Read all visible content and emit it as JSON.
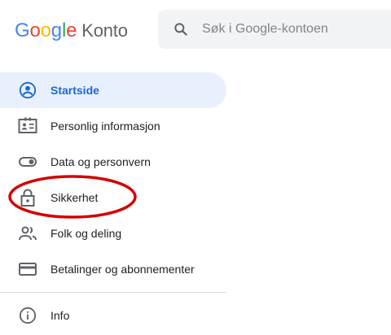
{
  "header": {
    "logo_letters": [
      "G",
      "o",
      "o",
      "g",
      "l",
      "e"
    ],
    "logo_suffix": "Konto",
    "search_placeholder": "Søk i Google-kontoen",
    "search_icon": "search-icon"
  },
  "nav": {
    "items": [
      {
        "label": "Startside",
        "icon": "account-circle-icon",
        "active": true
      },
      {
        "label": "Personlig informasjon",
        "icon": "id-card-icon"
      },
      {
        "label": "Data og personvern",
        "icon": "toggle-icon"
      },
      {
        "label": "Sikkerhet",
        "icon": "lock-icon"
      },
      {
        "label": "Folk og deling",
        "icon": "people-icon"
      },
      {
        "label": "Betalinger og abonnementer",
        "icon": "credit-card-icon"
      }
    ],
    "info": {
      "label": "Info",
      "icon": "info-icon"
    }
  },
  "colors": {
    "accent": "#1967d2",
    "active_bg": "#e8f0fe",
    "annotation": "#d50000"
  }
}
